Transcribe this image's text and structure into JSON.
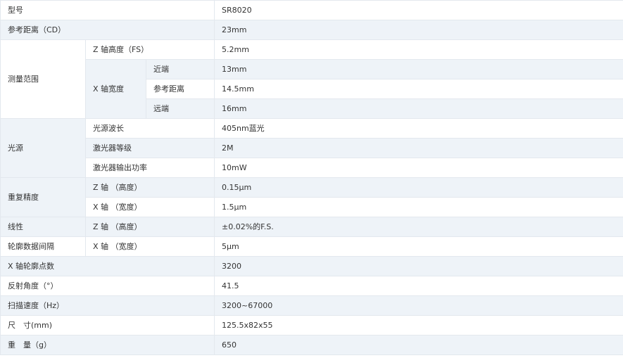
{
  "spec_table": {
    "model": {
      "label": "型号",
      "value": "SR8020"
    },
    "reference_distance": {
      "label": "参考距离（CD）",
      "value": "23mm"
    },
    "measurement_range": {
      "label": "测量范围",
      "z_axis_label": "Z 轴高度（FS）",
      "z_axis_value": "5.2mm",
      "x_axis_label": "X 轴宽度",
      "near_label": "近端",
      "near_value": "13mm",
      "ref_label": "参考距离",
      "ref_value": "14.5mm",
      "far_label": "远端",
      "far_value": "16mm"
    },
    "light_source": {
      "label": "光源",
      "wavelength_label": "光源波长",
      "wavelength_value": "405nm蓝光",
      "class_label": "激光器等级",
      "class_value": "2M",
      "power_label": "激光器输出功率",
      "power_value": "10mW"
    },
    "repeatability": {
      "label": "重复精度",
      "z_label": "Z 轴 （高度）",
      "z_value": "0.15μm",
      "x_label": "X 轴 （宽度）",
      "x_value": "1.5μm"
    },
    "linearity": {
      "label": "线性",
      "sub_label": "Z 轴 （高度）",
      "value": "±0.02%的F.S."
    },
    "profile_interval": {
      "label": "轮廓数据间隔",
      "sub_label": "X 轴 （宽度）",
      "value": "5μm"
    },
    "x_profile_points": {
      "label": "X 轴轮廓点数",
      "value": "3200"
    },
    "reflection_angle": {
      "label": "反射角度（°）",
      "value": "41.5"
    },
    "scan_speed": {
      "label": "扫描速度（Hz）",
      "value": "3200~67000"
    },
    "dimensions": {
      "label": "尺　寸(mm)",
      "value": "125.5x82x55"
    },
    "weight": {
      "label": "重　量（g）",
      "value": "650"
    }
  }
}
